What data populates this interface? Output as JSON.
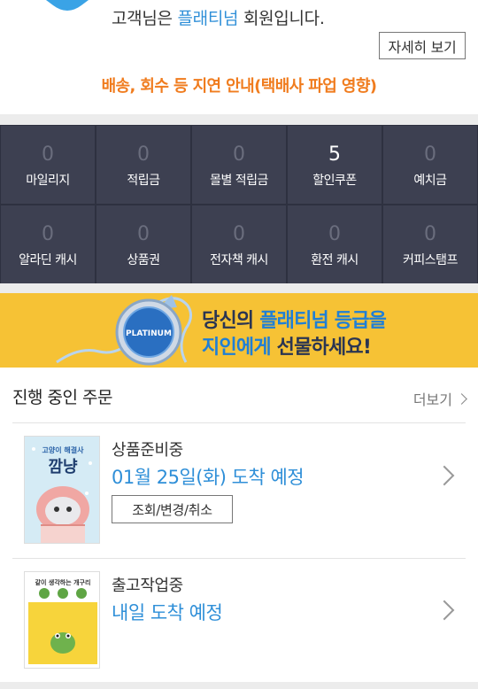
{
  "greeting": {
    "prefix": "고객님은 ",
    "grade": "플래티넘",
    "suffix": " 회원입니다.",
    "detail_button": "자세히 보기",
    "notice": "배송, 회수 등 지연 안내(택배사 파업 영향)"
  },
  "stats": [
    {
      "value": "0",
      "label": "마일리지",
      "active": false
    },
    {
      "value": "0",
      "label": "적립금",
      "active": false
    },
    {
      "value": "0",
      "label": "몰별 적립금",
      "active": false
    },
    {
      "value": "5",
      "label": "할인쿠폰",
      "active": true
    },
    {
      "value": "0",
      "label": "예치금",
      "active": false
    },
    {
      "value": "0",
      "label": "알라딘 캐시",
      "active": false
    },
    {
      "value": "0",
      "label": "상품권",
      "active": false
    },
    {
      "value": "0",
      "label": "전자책 캐시",
      "active": false
    },
    {
      "value": "0",
      "label": "환전 캐시",
      "active": false
    },
    {
      "value": "0",
      "label": "커피스탬프",
      "active": false
    }
  ],
  "banner": {
    "medal_text": "PLATINUM",
    "line1_prefix": "당신의 ",
    "line1_highlight": "플래티넘 등급을",
    "line2_highlight": "지인에게",
    "line2_suffix": " 선물하세요!"
  },
  "orders": {
    "title": "진행 중인 주문",
    "more_label": "더보기",
    "items": [
      {
        "status": "상품준비중",
        "eta": "01월 25일(화) 도착 예정",
        "action": "조회/변경/취소",
        "cover_title_small": "고양이 해결사",
        "cover_title_big": "깜냥"
      },
      {
        "status": "출고작업중",
        "eta": "내일 도착 예정",
        "cover_title_small": "같이 생각하는 개구리"
      }
    ]
  },
  "colors": {
    "accent_blue": "#2f8fd8",
    "notice_orange": "#f07c1e",
    "stats_bg": "#3d4051",
    "banner_yellow": "#f6c235"
  }
}
